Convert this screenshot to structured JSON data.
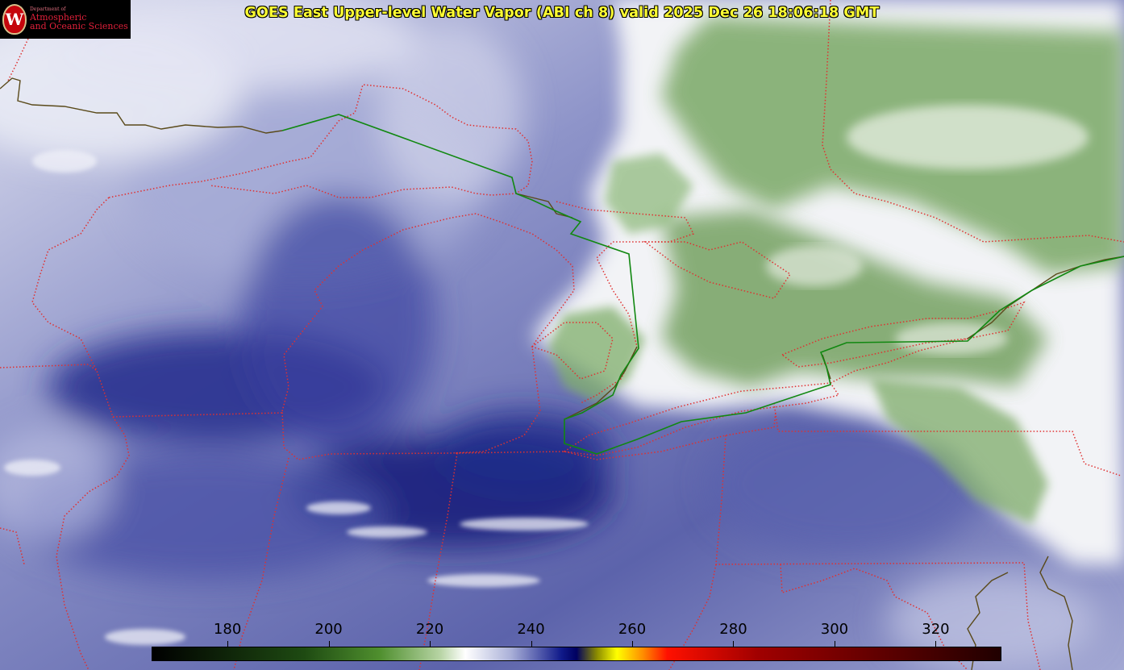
{
  "title": "GOES East Upper-level Water Vapor (ABI ch 8) valid 2025 Dec 26 18:06:18 GMT",
  "logo": {
    "department": "Department of",
    "line1": "Atmospheric",
    "line2": "and Oceanic Sciences",
    "seal": "W"
  },
  "colorbar": {
    "ticks": [
      "180",
      "200",
      "220",
      "240",
      "260",
      "280",
      "300",
      "320"
    ],
    "range": [
      165,
      333
    ],
    "unit_note": "",
    "stops": [
      {
        "v": 165,
        "c": "#000000"
      },
      {
        "v": 195,
        "c": "#1e4a12"
      },
      {
        "v": 210,
        "c": "#4f8f2e"
      },
      {
        "v": 222,
        "c": "#b7d4a4"
      },
      {
        "v": 227,
        "c": "#ffffff"
      },
      {
        "v": 236,
        "c": "#aab0d8"
      },
      {
        "v": 246,
        "c": "#101a8a"
      },
      {
        "v": 249,
        "c": "#000060"
      },
      {
        "v": 253,
        "c": "#8a8a00"
      },
      {
        "v": 257,
        "c": "#ffff00"
      },
      {
        "v": 262,
        "c": "#ff9000"
      },
      {
        "v": 267,
        "c": "#ff1000"
      },
      {
        "v": 285,
        "c": "#a00000"
      },
      {
        "v": 333,
        "c": "#200000"
      }
    ]
  },
  "map": {
    "colors": {
      "state_border": "#e03030",
      "coast_line": "#5a4a1a",
      "green_line": "#118811",
      "dry_blue": "#1a237e",
      "mid_blue": "#8c92c8",
      "moist_white": "#f4f4f8",
      "cold_green": "#6c9e55"
    }
  }
}
